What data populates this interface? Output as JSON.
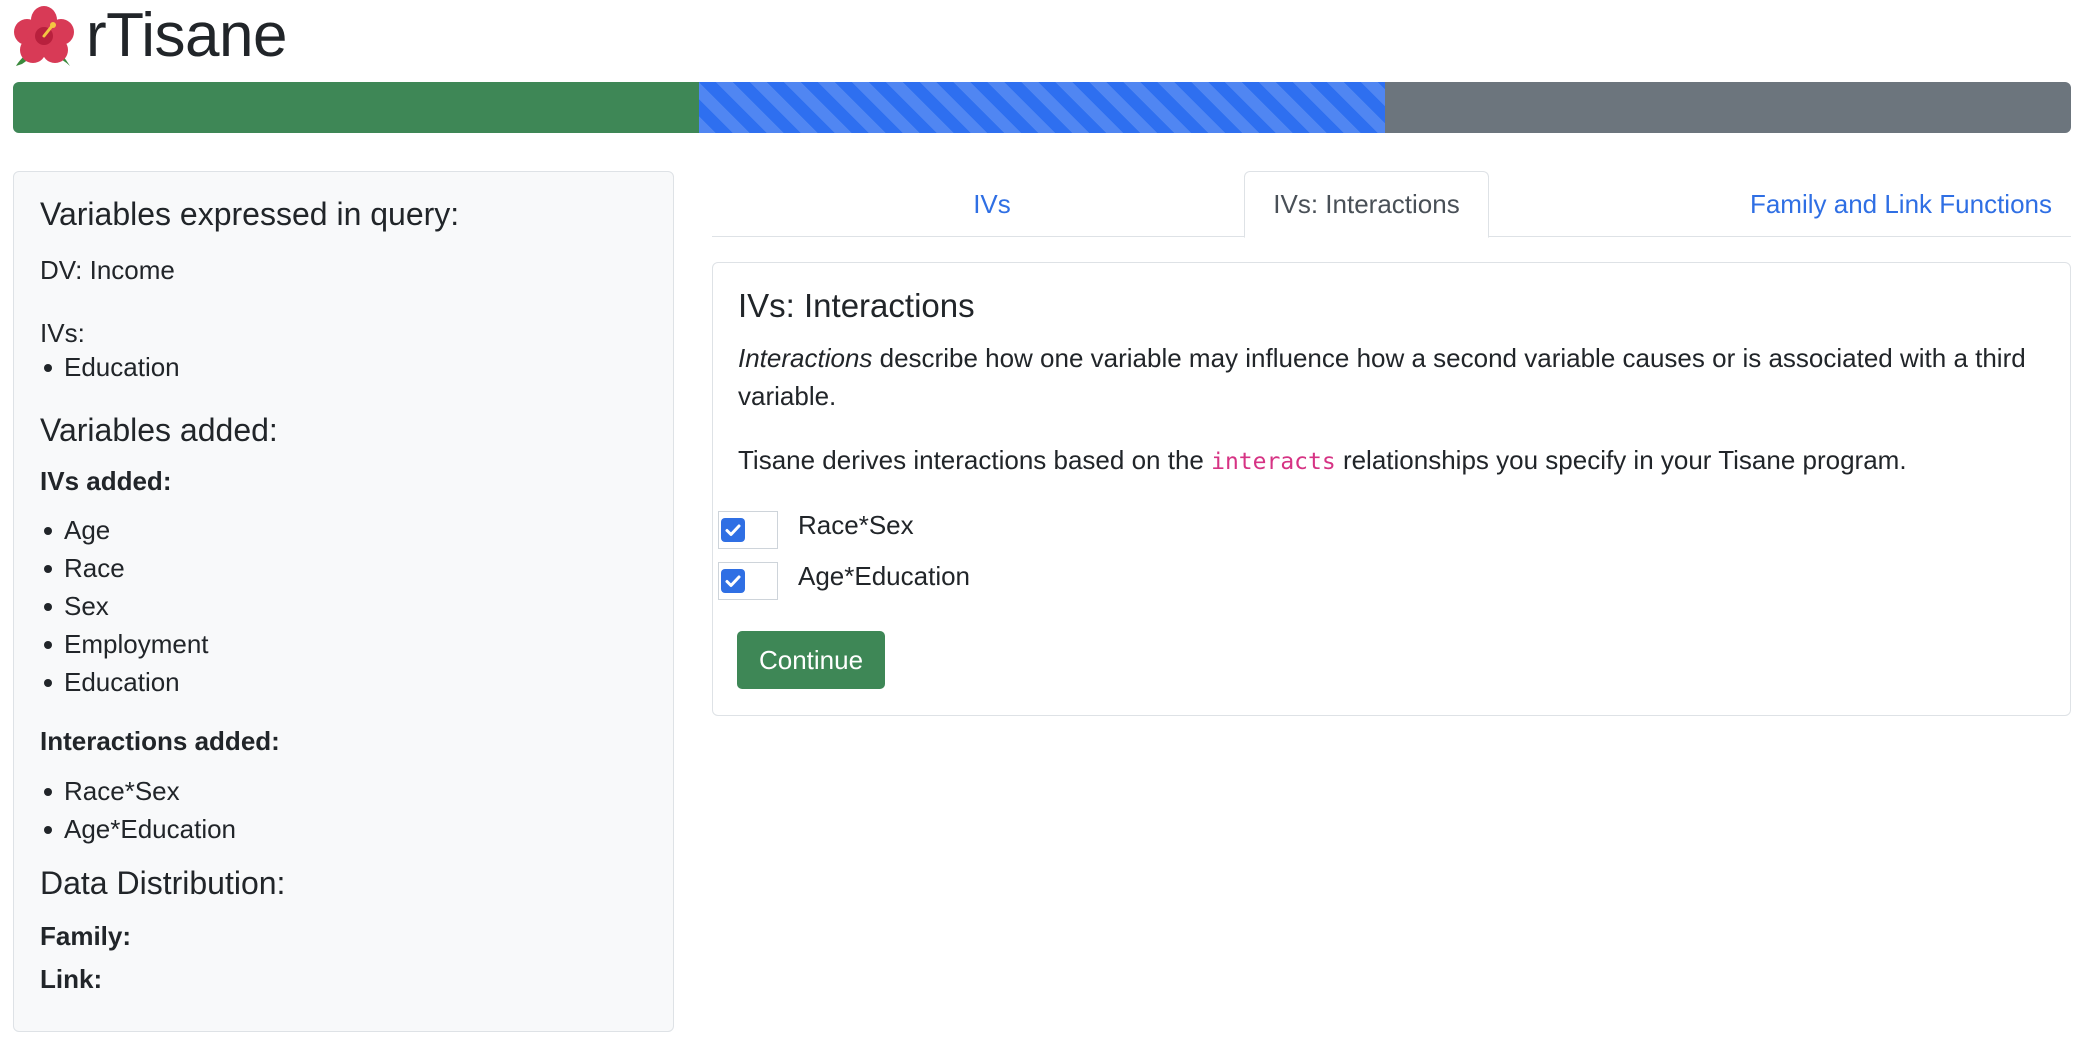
{
  "app": {
    "title": "rTisane",
    "logo_icon": "hibiscus-icon"
  },
  "progress": {
    "steps_total": 3,
    "steps_completed": 1,
    "current_step": 2,
    "colors": {
      "done": "#3e8756",
      "current": "#2e6ff0",
      "todo": "#6c757d"
    }
  },
  "sidebar": {
    "query_heading": "Variables expressed in query:",
    "dv_text": "DV: Income",
    "ivs_label": "IVs:",
    "query_ivs": [
      "Education"
    ],
    "added_heading": "Variables added:",
    "ivs_added_label": "IVs added:",
    "ivs_added": [
      "Age",
      "Race",
      "Sex",
      "Employment",
      "Education"
    ],
    "interactions_added_label": "Interactions added:",
    "interactions_added": [
      "Race*Sex",
      "Age*Education"
    ],
    "distribution_heading": "Data Distribution:",
    "family_label": "Family:",
    "link_label": "Link:"
  },
  "tabs": [
    {
      "label": "IVs",
      "active": false
    },
    {
      "label": "IVs: Interactions",
      "active": true
    },
    {
      "label": "Family and Link Functions",
      "active": false
    }
  ],
  "panel": {
    "title": "IVs: Interactions",
    "intro_em": "Interactions",
    "intro_rest": " describe how one variable may influence how a second variable causes or is associated with a third variable.",
    "derive_before": "Tisane derives interactions based on the ",
    "derive_code": "interacts",
    "derive_after": " relationships you specify in your Tisane program.",
    "checkboxes": [
      {
        "label": "Race*Sex",
        "checked": true
      },
      {
        "label": "Age*Education",
        "checked": true
      }
    ],
    "continue_label": "Continue"
  },
  "colors": {
    "accent": "#2f6fe4",
    "success": "#3e8756",
    "code": "#d63384"
  }
}
